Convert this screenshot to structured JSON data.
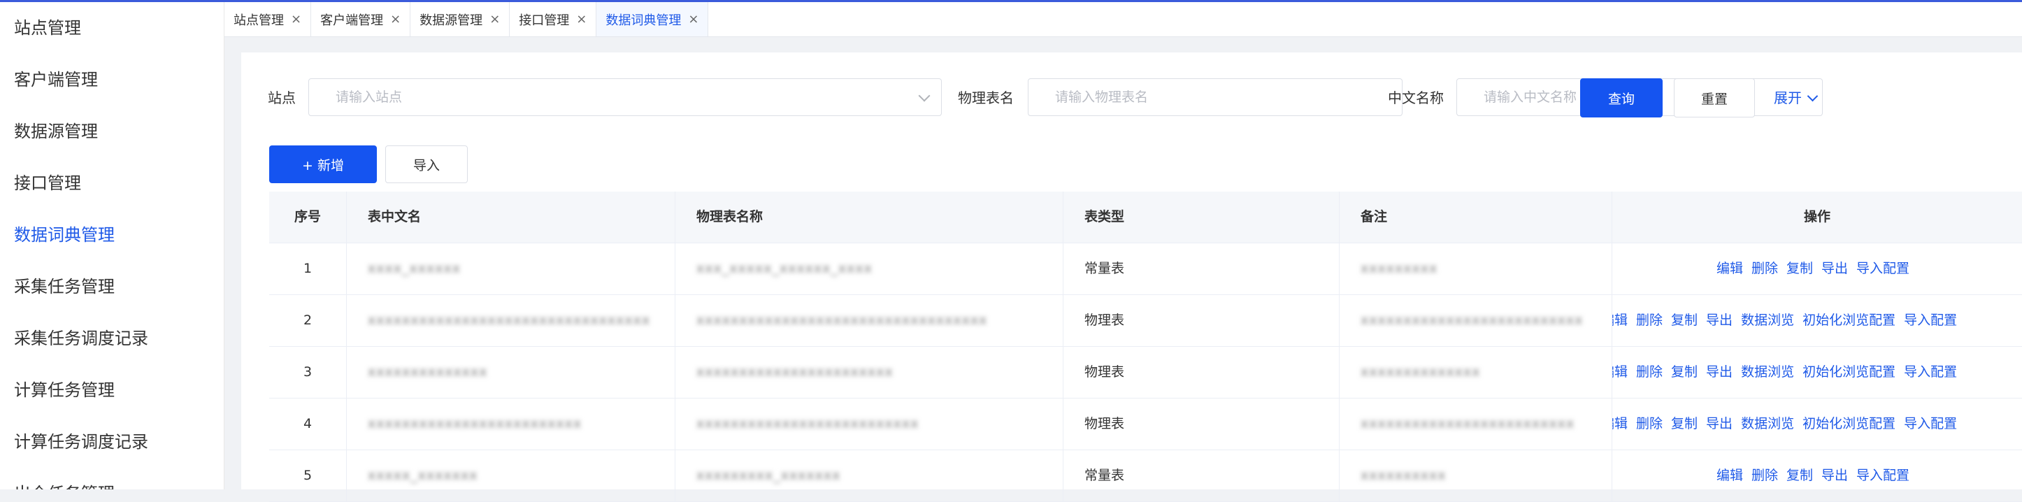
{
  "sidebar": {
    "items": [
      {
        "label": "站点管理",
        "active": false
      },
      {
        "label": "客户端管理",
        "active": false
      },
      {
        "label": "数据源管理",
        "active": false
      },
      {
        "label": "接口管理",
        "active": false
      },
      {
        "label": "数据词典管理",
        "active": true
      },
      {
        "label": "采集任务管理",
        "active": false
      },
      {
        "label": "采集任务调度记录",
        "active": false
      },
      {
        "label": "计算任务管理",
        "active": false
      },
      {
        "label": "计算任务调度记录",
        "active": false
      },
      {
        "label": "出仓任务管理",
        "active": false
      }
    ]
  },
  "tabs": [
    {
      "label": "站点管理",
      "close": "×",
      "active": false
    },
    {
      "label": "客户端管理",
      "close": "×",
      "active": false
    },
    {
      "label": "数据源管理",
      "close": "×",
      "active": false
    },
    {
      "label": "接口管理",
      "close": "×",
      "active": false
    },
    {
      "label": "数据词典管理",
      "close": "×",
      "active": true
    }
  ],
  "filters": {
    "site_label": "站点",
    "site_placeholder": "请输入站点",
    "physical_label": "物理表名",
    "physical_placeholder": "请输入物理表名",
    "cn_label": "中文名称",
    "cn_placeholder": "请输入中文名称",
    "query_button": "查询",
    "reset_button": "重置",
    "expand_label": "展开"
  },
  "actions": {
    "add_button": "+ 新增",
    "import_button": "导入"
  },
  "table": {
    "columns": [
      "序号",
      "表中文名",
      "物理表名称",
      "表类型",
      "备注",
      "操作"
    ],
    "rows": [
      {
        "no": "1",
        "cn_name": "xxxx_xxxxxx",
        "physical": "xxx_xxxxx_xxxxxx_xxxx",
        "type": "常量表",
        "remark": "xxxxxxxxx",
        "clipped": false,
        "ops": [
          "编辑",
          "删除",
          "复制",
          "导出",
          "导入配置"
        ]
      },
      {
        "no": "2",
        "cn_name": "xxxxxxxxxxxxxxxxxxxxxxxxxxxxxxxxx",
        "physical": "xxxxxxxxxxxxxxxxxxxxxxxxxxxxxxxxxx",
        "type": "物理表",
        "remark": "xxxxxxxxxxxxxxxxxxxxxxxxxx",
        "clipped": true,
        "ops": [
          "编辑",
          "删除",
          "复制",
          "导出",
          "数据浏览",
          "初始化浏览配置",
          "导入配置"
        ]
      },
      {
        "no": "3",
        "cn_name": "xxxxxxxxxxxxxx",
        "physical": "xxxxxxxxxxxxxxxxxxxxxxx",
        "type": "物理表",
        "remark": "xxxxxxxxxxxxxx",
        "clipped": true,
        "ops": [
          "编辑",
          "删除",
          "复制",
          "导出",
          "数据浏览",
          "初始化浏览配置",
          "导入配置"
        ]
      },
      {
        "no": "4",
        "cn_name": "xxxxxxxxxxxxxxxxxxxxxxxxx",
        "physical": "xxxxxxxxxxxxxxxxxxxxxxxxxx",
        "type": "物理表",
        "remark": "xxxxxxxxxxxxxxxxxxxxxxxxx",
        "clipped": true,
        "ops": [
          "编辑",
          "删除",
          "复制",
          "导出",
          "数据浏览",
          "初始化浏览配置",
          "导入配置"
        ]
      },
      {
        "no": "5",
        "cn_name": "xxxxx_xxxxxxx",
        "physical": "xxxxxxxxx_xxxxxxx",
        "type": "常量表",
        "remark": "xxxxxxxxxx",
        "clipped": false,
        "ops": [
          "编辑",
          "删除",
          "复制",
          "导出",
          "导入配置"
        ]
      }
    ]
  }
}
